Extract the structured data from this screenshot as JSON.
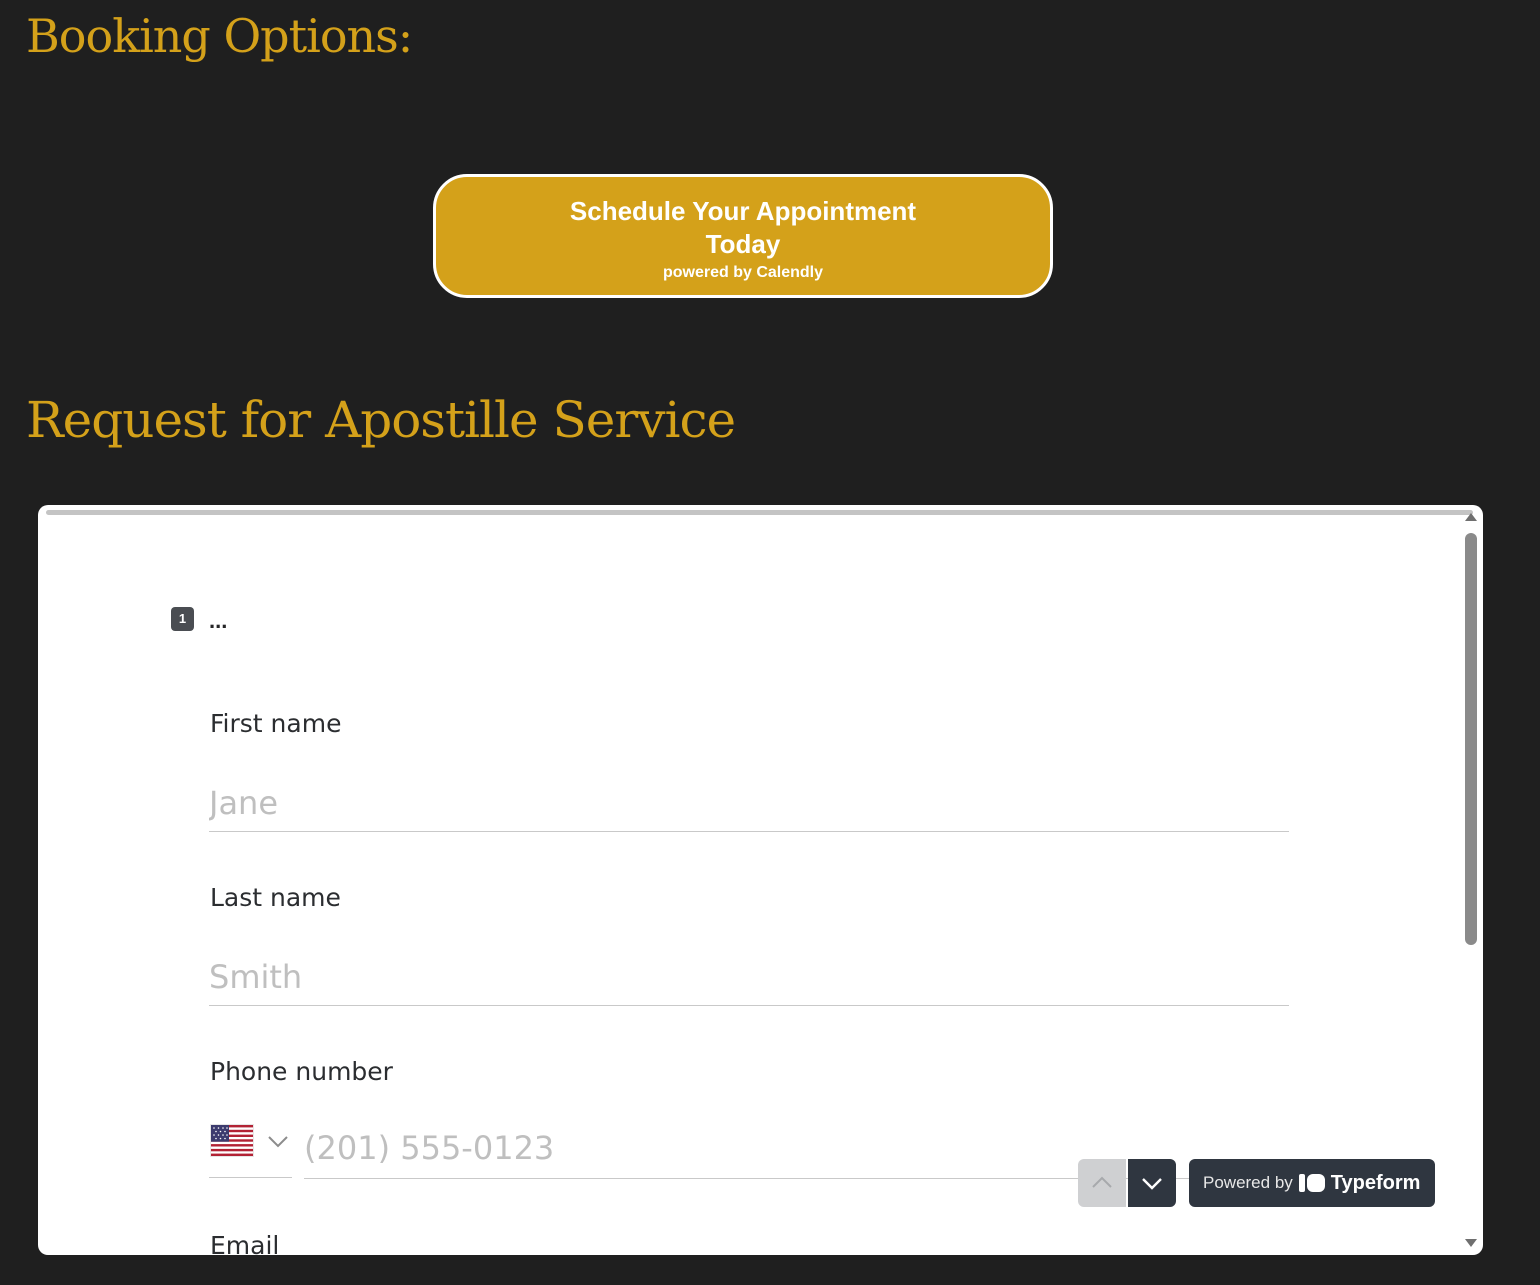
{
  "booking": {
    "title": "Booking Options:",
    "button": {
      "line1": "Schedule Your Appointment",
      "line2": "Today",
      "line3": "powered by Calendly"
    }
  },
  "apostille": {
    "title": "Request for Apostille Service"
  },
  "form": {
    "question_number": "1",
    "question_text": "...",
    "fields": {
      "first_name": {
        "label": "First name",
        "placeholder": "Jane",
        "value": ""
      },
      "last_name": {
        "label": "Last name",
        "placeholder": "Smith",
        "value": ""
      },
      "phone": {
        "label": "Phone number",
        "placeholder": "(201) 555-0123",
        "country": "United States",
        "value": ""
      },
      "email": {
        "label": "Email"
      }
    },
    "nav": {
      "up_icon": "chevron-up-icon",
      "down_icon": "chevron-down-icon"
    },
    "branding": {
      "prefix": "Powered by",
      "name": "Typeform"
    }
  },
  "colors": {
    "page_background": "#1f1f1f",
    "accent_gold": "#d4a11a",
    "form_background": "#ffffff",
    "nav_dark": "#2f3640",
    "placeholder": "#bfbfbf"
  }
}
